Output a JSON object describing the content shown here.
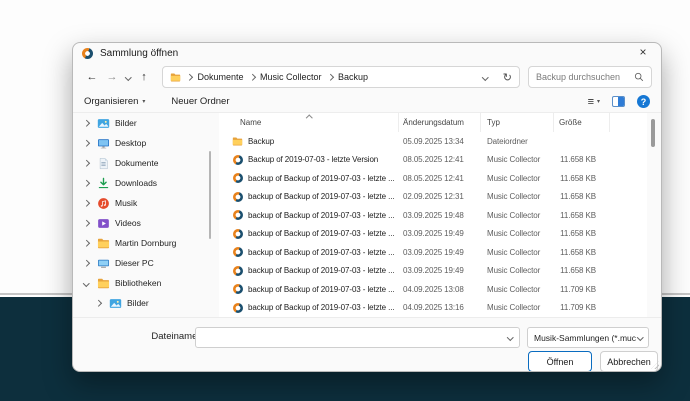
{
  "window": {
    "title": "Sammlung öffnen",
    "close_glyph": "×"
  },
  "address": {
    "nav": {
      "back_glyph": "←",
      "forward_glyph": "→",
      "up_glyph": "↑",
      "refresh_glyph": "↻"
    },
    "crumbs": [
      "Dokumente",
      "Music Collector",
      "Backup"
    ],
    "search_placeholder": "Backup durchsuchen"
  },
  "toolbar": {
    "organize_label": "Organisieren",
    "new_folder_label": "Neuer Ordner",
    "view_glyph": "≡",
    "help_glyph": "?"
  },
  "sidebar": {
    "items": [
      {
        "label": "Bilder",
        "icon": "pictures",
        "expanded": false,
        "indent": 0
      },
      {
        "label": "Desktop",
        "icon": "desktop",
        "expanded": false,
        "indent": 0
      },
      {
        "label": "Dokumente",
        "icon": "documents",
        "expanded": false,
        "indent": 0
      },
      {
        "label": "Downloads",
        "icon": "downloads",
        "expanded": false,
        "indent": 0
      },
      {
        "label": "Musik",
        "icon": "music",
        "expanded": false,
        "indent": 0
      },
      {
        "label": "Videos",
        "icon": "videos",
        "expanded": false,
        "indent": 0
      },
      {
        "label": "Martin Dornburg",
        "icon": "folder",
        "expanded": false,
        "indent": 0
      },
      {
        "label": "Dieser PC",
        "icon": "computer",
        "expanded": false,
        "indent": 0
      },
      {
        "label": "Bibliotheken",
        "icon": "library",
        "expanded": true,
        "indent": 0
      },
      {
        "label": "Bilder",
        "icon": "pictures",
        "expanded": false,
        "indent": 1
      }
    ]
  },
  "filelist": {
    "columns": [
      "Name",
      "Änderungsdatum",
      "Typ",
      "Größe"
    ],
    "sort": {
      "column": "Name",
      "direction": "ascending"
    },
    "rows": [
      {
        "name": "Backup",
        "icon": "folder",
        "date": "05.09.2025 13:34",
        "type": "Dateiordner",
        "size": ""
      },
      {
        "name": "Backup of 2019-07-03 - letzte Version",
        "icon": "muc",
        "date": "08.05.2025 12:41",
        "type": "Music Collector",
        "size": "11.658 KB"
      },
      {
        "name": "backup of Backup of 2019-07-03 - letzte ...",
        "icon": "muc",
        "date": "08.05.2025 12:41",
        "type": "Music Collector",
        "size": "11.658 KB"
      },
      {
        "name": "backup of Backup of 2019-07-03 - letzte ...",
        "icon": "muc",
        "date": "02.09.2025 12:31",
        "type": "Music Collector",
        "size": "11.658 KB"
      },
      {
        "name": "backup of Backup of 2019-07-03 - letzte ...",
        "icon": "muc",
        "date": "03.09.2025 19:48",
        "type": "Music Collector",
        "size": "11.658 KB"
      },
      {
        "name": "backup of Backup of 2019-07-03 - letzte ...",
        "icon": "muc",
        "date": "03.09.2025 19:49",
        "type": "Music Collector",
        "size": "11.658 KB"
      },
      {
        "name": "backup of Backup of 2019-07-03 - letzte ...",
        "icon": "muc",
        "date": "03.09.2025 19:49",
        "type": "Music Collector",
        "size": "11.658 KB"
      },
      {
        "name": "backup of Backup of 2019-07-03 - letzte ...",
        "icon": "muc",
        "date": "03.09.2025 19:49",
        "type": "Music Collector",
        "size": "11.658 KB"
      },
      {
        "name": "backup of Backup of 2019-07-03 - letzte ...",
        "icon": "muc",
        "date": "04.09.2025 13:08",
        "type": "Music Collector",
        "size": "11.709 KB"
      },
      {
        "name": "backup of Backup of 2019-07-03 - letzte ...",
        "icon": "muc",
        "date": "04.09.2025 13:16",
        "type": "Music Collector",
        "size": "11.709 KB"
      }
    ]
  },
  "footer": {
    "filename_label": "Dateiname:",
    "filename_value": "",
    "filetype_value": "Musik-Sammlungen (*.muc",
    "open_label": "Öffnen",
    "cancel_label": "Abbrechen"
  },
  "colors": {
    "accent_blue": "#0a6cc0",
    "desktop_teal": "#0d2f3d",
    "folder_yellow": "#ffd05c",
    "logo_orange": "#e8821c",
    "logo_blue": "#1b4f6e"
  }
}
